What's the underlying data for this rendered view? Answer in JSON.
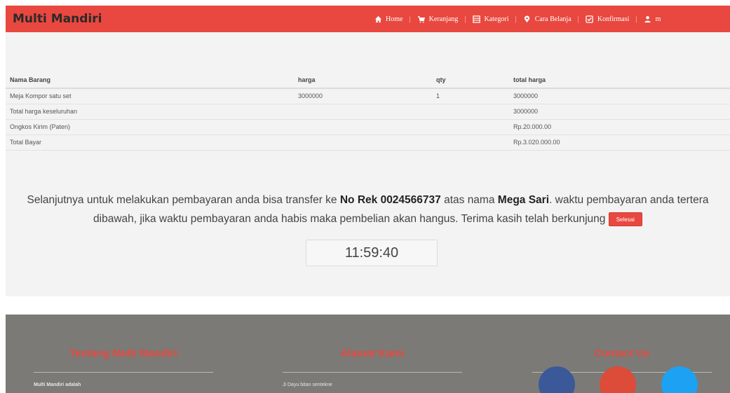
{
  "navbar": {
    "brand": "Multi Mandiri",
    "links": [
      {
        "label": "Home",
        "icon": "home-icon"
      },
      {
        "label": "Keranjang",
        "icon": "cart-icon"
      },
      {
        "label": "Kategori",
        "icon": "list-icon"
      },
      {
        "label": "Cara Belanja",
        "icon": "map-marker-icon"
      },
      {
        "label": "Konfirmasi",
        "icon": "check-icon"
      },
      {
        "label": "m",
        "icon": "user-icon"
      }
    ]
  },
  "cart": {
    "headers": [
      "Nama Barang",
      "harga",
      "qty",
      "total harga"
    ],
    "items": [
      {
        "name": "Meja Kompor satu set",
        "price": "3000000",
        "qty": "1",
        "total": "3000000"
      }
    ],
    "summary": [
      {
        "label": "Total harga keseluruhan",
        "value": "3000000"
      },
      {
        "label": "Ongkos Kirim (Paten)",
        "value": "Rp.20.000.00"
      },
      {
        "label": "Total Bayar",
        "value": "Rp.3.020.000.00"
      }
    ]
  },
  "message": {
    "part1": "Selanjutnya untuk melakukan pembayaran anda bisa transfer ke ",
    "account": "No Rek 0024566737",
    "part2": " atas nama ",
    "name": "Mega Sari",
    "part3": ". waktu pembayaran anda tertera",
    "line2": "dibawah, jika waktu pembayaran anda habis maka pembelian akan hangus. Terima kasih telah berkunjung ",
    "button": "Selesai"
  },
  "timer": "11:59:40",
  "footer": {
    "about_title": "Tentang Multi Mandiri",
    "about_text": "Multi Mandiri adalah",
    "address_title": "Alamat Kami",
    "address_text": "Ji Dayu bitan sentekne",
    "contact_title": "Contact Us"
  },
  "colors": {
    "accent": "#e8483f",
    "footer_bg": "#7b7a76",
    "facebook": "#3b5998",
    "google": "#dd4b39",
    "twitter": "#1da1f2"
  }
}
